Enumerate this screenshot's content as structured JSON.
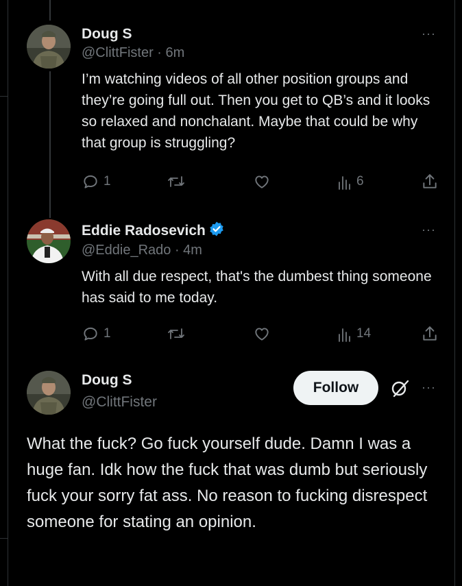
{
  "tweets": [
    {
      "name": "Doug S",
      "handle_line": "@ClittFister · 6m",
      "text": "I’m watching videos of all other position groups and they’re going full out. Then you get to QB’s and it looks so relaxed and nonchalant. Maybe that could be why that group is struggling?",
      "replies": "1",
      "retweets": "",
      "likes": "",
      "views": "6"
    },
    {
      "name": "Eddie Radosevich",
      "handle_line": "@Eddie_Rado · 4m",
      "text": "With all due respect, that's the dumbest thing someone has said to me today.",
      "replies": "1",
      "retweets": "",
      "likes": "",
      "views": "14",
      "verified": true
    }
  ],
  "focused_tweet": {
    "name": "Doug S",
    "handle": "@ClittFister",
    "follow_label": "Follow",
    "text": "What the fuck? Go fuck yourself dude. Damn I was a huge fan. Idk how the fuck that was dumb but seriously fuck your sorry fat ass. No reason to fucking disrespect someone for stating an opinion."
  },
  "more_label": "···",
  "colors": {
    "background": "#000000",
    "text": "#e7e9ea",
    "muted": "#71767b",
    "verified": "#1d9bf0",
    "follow_bg": "#eff3f4"
  },
  "icons": [
    "reply-icon",
    "retweet-icon",
    "like-icon",
    "views-icon",
    "share-icon",
    "verified-badge-icon",
    "grok-icon",
    "more-icon"
  ]
}
